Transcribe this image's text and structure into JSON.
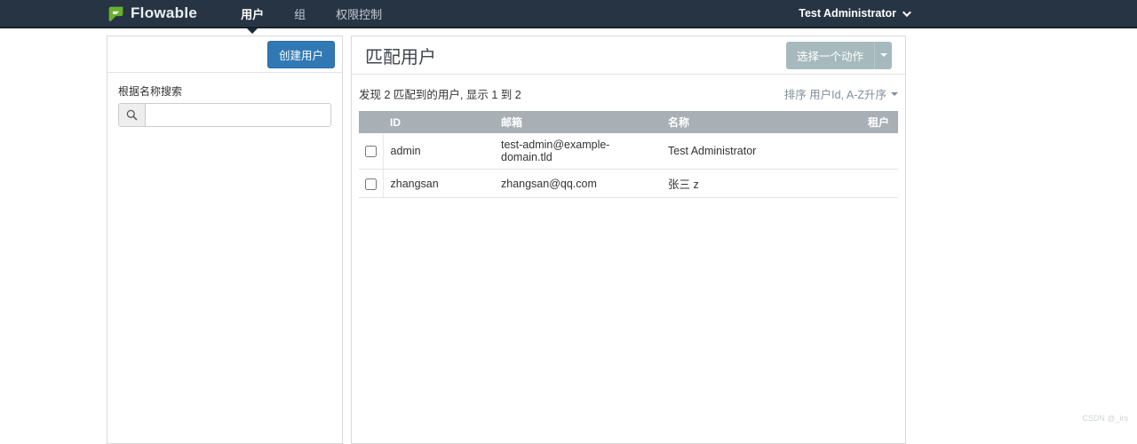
{
  "navbar": {
    "brand": "Flowable",
    "items": [
      {
        "label": "用户",
        "active": true
      },
      {
        "label": "组",
        "active": false
      },
      {
        "label": "权限控制",
        "active": false
      }
    ],
    "user_menu_label": "Test Administrator"
  },
  "sidebar": {
    "create_button_label": "创建用户",
    "filter_label": "根据名称搜索",
    "search_value": "",
    "search_placeholder": ""
  },
  "main": {
    "title": "匹配用户",
    "action_button_label": "选择一个动作",
    "summary": "发现 2 匹配到的用户, 显示 1 到 2",
    "sort_label": "排序 用户Id, A-Z升序",
    "table": {
      "headers": [
        "ID",
        "邮箱",
        "名称",
        "租户"
      ],
      "rows": [
        {
          "id": "admin",
          "email": "test-admin@example-domain.tld",
          "name": "Test Administrator",
          "tenant": ""
        },
        {
          "id": "zhangsan",
          "email": "zhangsan@qq.com",
          "name": "张三 z",
          "tenant": ""
        }
      ]
    }
  },
  "watermark": "CSDN @_irs",
  "colors": {
    "navbar_bg": "#263443",
    "navbar_border": "#16212e",
    "primary_button": "#3079b5",
    "disabled_action_button": "#a6babd",
    "table_header_bg": "#a8afb5",
    "brand_green": "#68b12f"
  }
}
